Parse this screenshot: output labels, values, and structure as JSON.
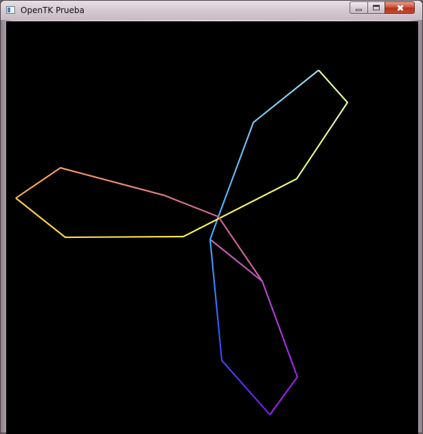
{
  "window": {
    "title": "OpenTK Prueba",
    "icon": "app-window-icon",
    "caption_buttons": [
      {
        "name": "minimize-button",
        "icon": "minimize-icon"
      },
      {
        "name": "maximize-button",
        "icon": "maximize-icon"
      },
      {
        "name": "close-button",
        "icon": "close-icon"
      }
    ]
  },
  "canvas": {
    "background": "#000000",
    "shape": "three-blade-propeller-outline",
    "stroke_colors": {
      "yellow": "#ffee44",
      "orange": "#ffaa55",
      "pink": "#dd7799",
      "magenta": "#aa33dd",
      "violet": "#6633ee",
      "blue": "#3366ff",
      "sky": "#44aaff",
      "cyan": "#99ddee"
    }
  }
}
